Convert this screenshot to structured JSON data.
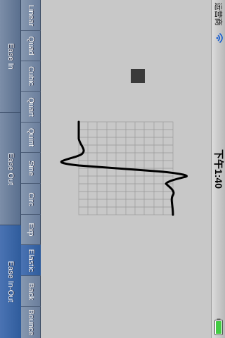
{
  "status_bar": {
    "carrier": "运营商",
    "time": "下午1:40"
  },
  "ease_types": {
    "items": [
      {
        "label": "Ease In"
      },
      {
        "label": "Ease Out"
      },
      {
        "label": "Ease In-Out"
      }
    ],
    "selected_index": 2
  },
  "functions": {
    "items": [
      {
        "label": "Linear"
      },
      {
        "label": "Quad"
      },
      {
        "label": "Cubic"
      },
      {
        "label": "Quart"
      },
      {
        "label": "Quint"
      },
      {
        "label": "Sine"
      },
      {
        "label": "Circ"
      },
      {
        "label": "Exp"
      },
      {
        "label": "Elastic"
      },
      {
        "label": "Back"
      },
      {
        "label": "Bounce"
      }
    ],
    "selected_index": 8
  },
  "colors": {
    "accent": "#2f5c9c",
    "curve": "#000000",
    "grid": "#9a9a9a",
    "square": "#3a3a3a",
    "battery": "#44cc44"
  },
  "icons": {
    "wifi": "wifi-icon",
    "battery": "battery-icon"
  }
}
